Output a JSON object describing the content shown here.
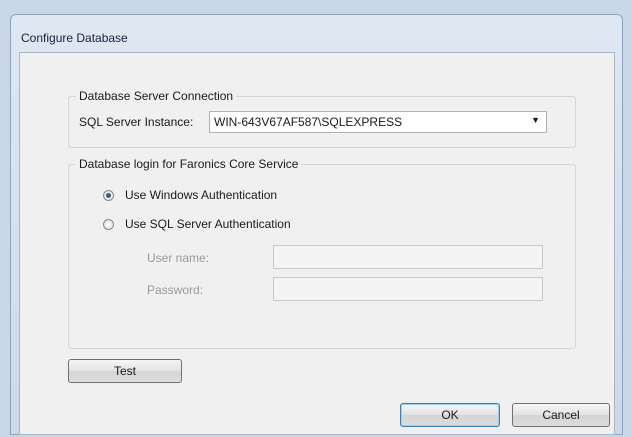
{
  "window": {
    "title": "Configure Database"
  },
  "connection_group": {
    "title": "Database Server Connection",
    "instance_label": "SQL Server Instance:",
    "instance_value": "WIN-643V67AF587\\SQLEXPRESS",
    "dropdown_icon": "dropdown-arrow"
  },
  "login_group": {
    "title": "Database login for Faronics Core Service",
    "windows_auth_label": "Use Windows Authentication",
    "sql_auth_label": "Use SQL Server Authentication",
    "selected": "windows",
    "username_label": "User name:",
    "username_value": "",
    "password_label": "Password:",
    "password_value": ""
  },
  "buttons": {
    "test": "Test",
    "ok": "OK",
    "cancel": "Cancel"
  }
}
